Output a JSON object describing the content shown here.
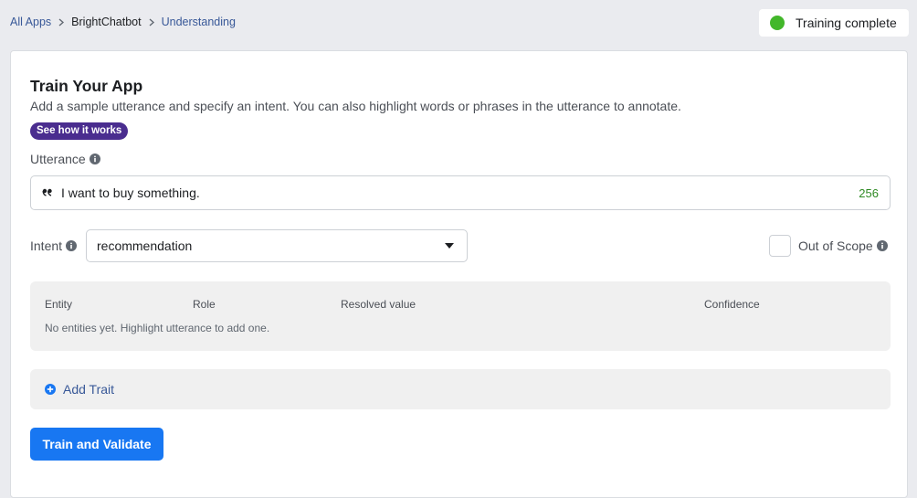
{
  "breadcrumb": {
    "items": [
      {
        "label": "All Apps"
      },
      {
        "label": "BrightChatbot"
      },
      {
        "label": "Understanding"
      }
    ]
  },
  "status": {
    "text": "Training complete",
    "color": "#42b72a"
  },
  "card": {
    "title": "Train Your App",
    "subtitle": "Add a sample utterance and specify an intent. You can also highlight words or phrases in the utterance to annotate.",
    "how_link": "See how it works"
  },
  "utterance": {
    "label": "Utterance",
    "value": "I want to buy something.",
    "char_count": "256"
  },
  "intent": {
    "label": "Intent",
    "selected": "recommendation"
  },
  "out_of_scope": {
    "label": "Out of Scope",
    "checked": false
  },
  "entities": {
    "columns": [
      "Entity",
      "Role",
      "Resolved value",
      "Confidence"
    ],
    "empty_text": "No entities yet. Highlight utterance to add one."
  },
  "trait": {
    "label": "Add Trait"
  },
  "actions": {
    "train_label": "Train and Validate"
  },
  "colors": {
    "primary": "#1877f2",
    "link": "#385898",
    "pill": "#4a2d8f",
    "count": "#2f8a24"
  },
  "icons": [
    "chevron-right-icon",
    "info-icon",
    "quote-icon",
    "caret-down-icon",
    "plus-circle-icon"
  ]
}
